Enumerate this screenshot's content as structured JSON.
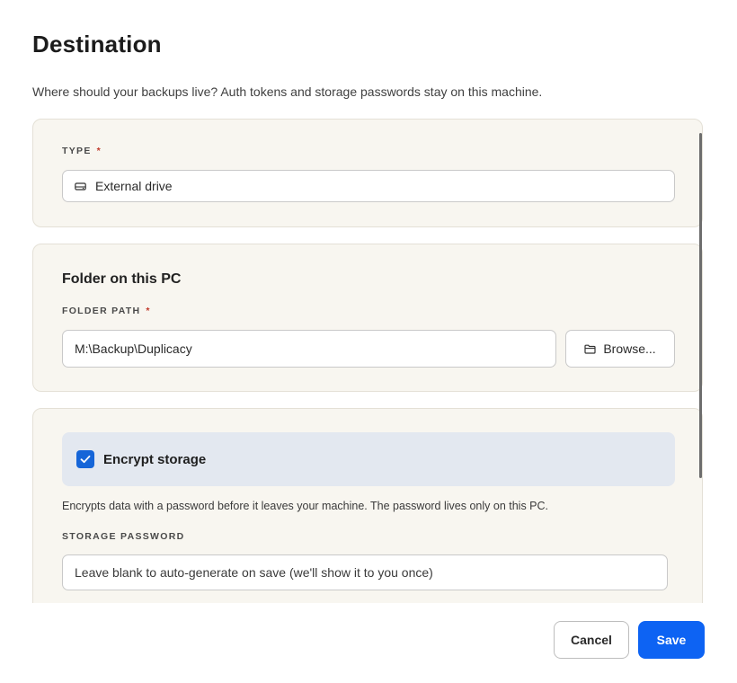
{
  "header": {
    "title": "Destination",
    "subtitle": "Where should your backups live? Auth tokens and storage passwords stay on this machine."
  },
  "type_card": {
    "label": "TYPE",
    "required_mark": "*",
    "value": "External drive",
    "icon": "drive-icon"
  },
  "folder_card": {
    "heading": "Folder on this PC",
    "label": "FOLDER PATH",
    "required_mark": "*",
    "path_value": "M:\\Backup\\Duplicacy",
    "browse_label": "Browse...",
    "browse_icon": "folder-icon"
  },
  "encryption_card": {
    "checkbox_label": "Encrypt storage",
    "checked": true,
    "help_text": "Encrypts data with a password before it leaves your machine. The password lives only on this PC.",
    "password_label": "STORAGE PASSWORD",
    "password_placeholder": "Leave blank to auto-generate on save (we'll show it to you once)"
  },
  "footer": {
    "cancel_label": "Cancel",
    "save_label": "Save"
  },
  "colors": {
    "accent": "#0d63f3",
    "card_background": "#f8f6f0",
    "encrypt_highlight": "#e3e8f0",
    "required": "#c0392b"
  }
}
